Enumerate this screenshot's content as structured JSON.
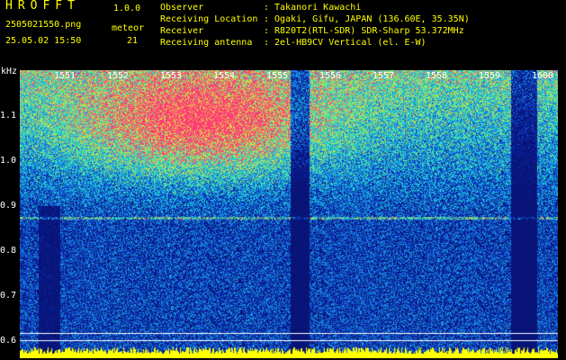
{
  "header": {
    "app_title": "HROFFT",
    "app_version": "1.0.0",
    "file_name": "2505021550.png",
    "timestamp": "25.05.02 15:50",
    "meteor_label": "meteor",
    "meteor_count": "21",
    "rows": [
      {
        "label": "Observer",
        "sep": ":",
        "value": "Takanori Kawachi"
      },
      {
        "label": "Receiving Location",
        "sep": ":",
        "value": "Ogaki, Gifu, JAPAN (136.60E, 35.35N)"
      },
      {
        "label": "Receiver",
        "sep": ":",
        "value": "R820T2(RTL-SDR) SDR-Sharp 53.372MHz"
      },
      {
        "label": "Receiving antenna",
        "sep": ":",
        "value": "2el-HB9CV Vertical (el. E-W)"
      }
    ]
  },
  "spectrogram": {
    "y_unit": "kHz",
    "y_ticks": [
      "1.1",
      "1.0",
      "0.9",
      "0.8",
      "0.7",
      "0.6"
    ],
    "x_ticks": [
      "1551",
      "1552",
      "1553",
      "1554",
      "1555",
      "1556",
      "1557",
      "1558",
      "1559",
      "1600"
    ],
    "colors": {
      "low": "#0a1a8c",
      "mid": "#1e6fd9",
      "high": "#18d8d0",
      "peak": "#ff3a7a",
      "signal": "#ffff00"
    }
  }
}
